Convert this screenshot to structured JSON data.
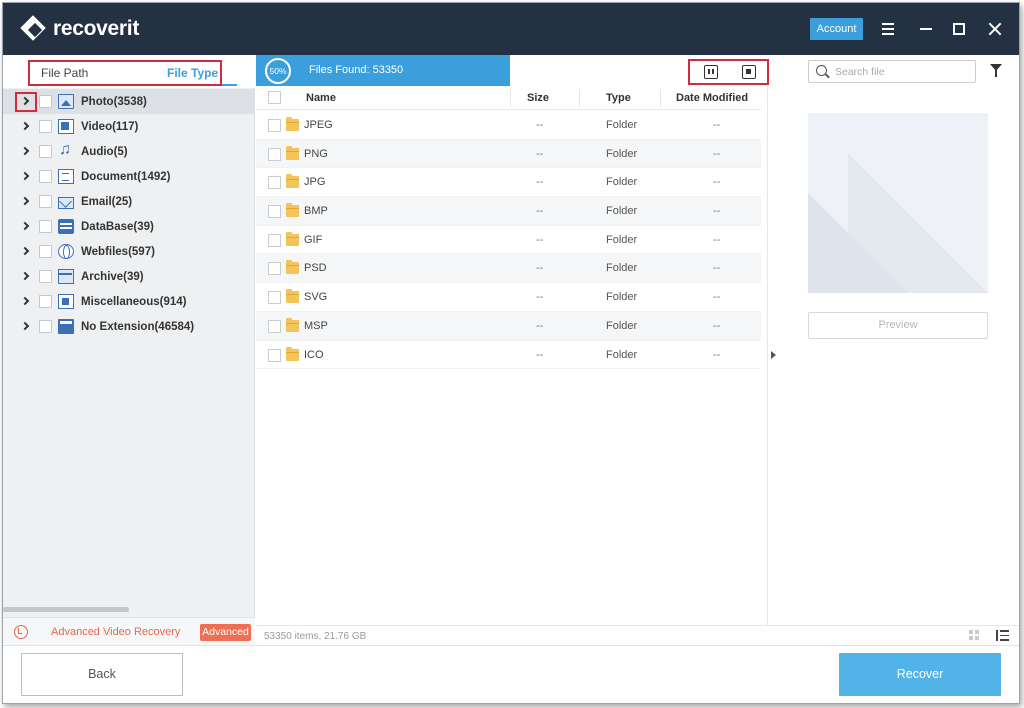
{
  "app": {
    "title": "recoverit",
    "account_label": "Account"
  },
  "sidebar": {
    "tabs": [
      {
        "label": "File Path",
        "active": false
      },
      {
        "label": "File Type",
        "active": true
      }
    ],
    "tree": [
      {
        "label": "Photo(3538)",
        "icon": "photo-icon",
        "selected": true
      },
      {
        "label": "Video(117)",
        "icon": "video-icon"
      },
      {
        "label": "Audio(5)",
        "icon": "audio-icon"
      },
      {
        "label": "Document(1492)",
        "icon": "document-icon"
      },
      {
        "label": "Email(25)",
        "icon": "email-icon"
      },
      {
        "label": "DataBase(39)",
        "icon": "database-icon"
      },
      {
        "label": "Webfiles(597)",
        "icon": "webfiles-icon"
      },
      {
        "label": "Archive(39)",
        "icon": "archive-icon"
      },
      {
        "label": "Miscellaneous(914)",
        "icon": "miscellaneous-icon"
      },
      {
        "label": "No Extension(46584)",
        "icon": "no-extension-icon"
      }
    ],
    "advanced": {
      "label": "Advanced Video Recovery",
      "badge": "Advanced"
    }
  },
  "scan": {
    "progress_label": "50%",
    "progress": 0.5,
    "files_found": "Files Found: 53350"
  },
  "table": {
    "columns": [
      "Name",
      "Size",
      "Type",
      "Date Modified"
    ],
    "rows": [
      {
        "name": "JPEG",
        "size": "--",
        "type": "Folder",
        "date": "--"
      },
      {
        "name": "PNG",
        "size": "--",
        "type": "Folder",
        "date": "--"
      },
      {
        "name": "JPG",
        "size": "--",
        "type": "Folder",
        "date": "--"
      },
      {
        "name": "BMP",
        "size": "--",
        "type": "Folder",
        "date": "--"
      },
      {
        "name": "GIF",
        "size": "--",
        "type": "Folder",
        "date": "--"
      },
      {
        "name": "PSD",
        "size": "--",
        "type": "Folder",
        "date": "--"
      },
      {
        "name": "SVG",
        "size": "--",
        "type": "Folder",
        "date": "--"
      },
      {
        "name": "MSP",
        "size": "--",
        "type": "Folder",
        "date": "--"
      },
      {
        "name": "ICO",
        "size": "--",
        "type": "Folder",
        "date": "--"
      }
    ]
  },
  "search": {
    "placeholder": "Search file"
  },
  "preview": {
    "button_label": "Preview"
  },
  "status": {
    "items_text": "53350 items, 21.76  GB"
  },
  "footer": {
    "back_label": "Back",
    "recover_label": "Recover"
  },
  "colors": {
    "accent": "#3a9fdc",
    "titlebar": "#233142",
    "highlight": "#d12b3c",
    "advanced": "#ee6f52"
  }
}
